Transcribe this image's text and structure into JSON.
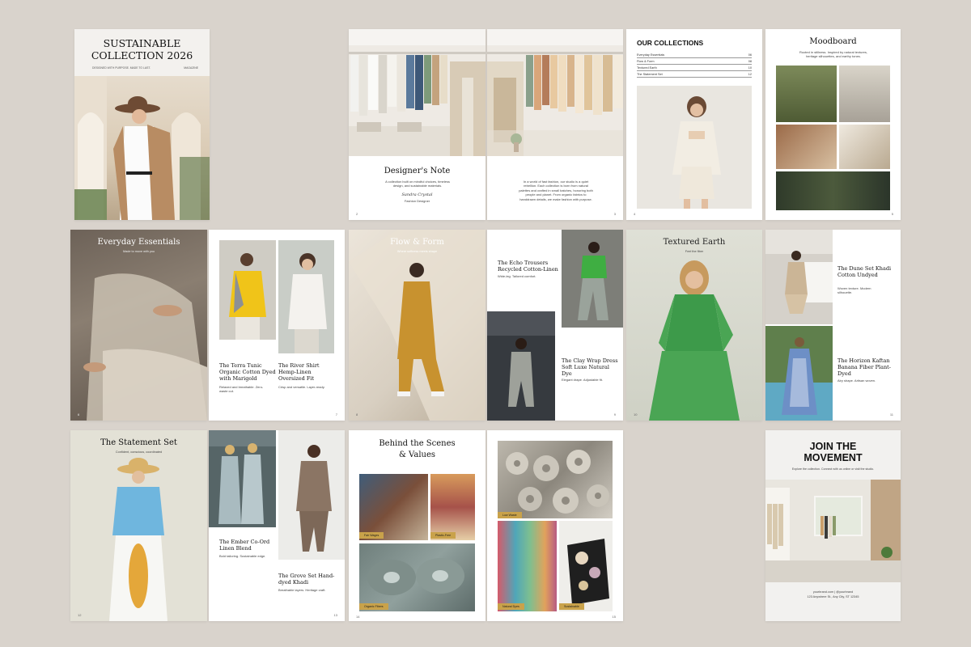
{
  "cover": {
    "title_line1": "SUSTAINABLE",
    "title_line2": "COLLECTION 2026",
    "subtitle": "DESIGNED WITH PURPOSE. MADE TO LAST.",
    "label": "MAGAZINE"
  },
  "designer_note": {
    "title": "Designer's Note",
    "intro": "A collection built on mindful choices, timeless design, and sustainable materials.",
    "signature": "Sandra Crystal",
    "role": "Fashion Designer",
    "body": "In a world of fast fashion, our studio is a quiet rebellion. Each collection is born from natural palettes and crafted in small batches, honoring both people and planet. From organic fabrics to handdrawn details, we make fashion with purpose.",
    "page_left": "2",
    "page_right": "3"
  },
  "collections": {
    "title": "OUR COLLECTIONS",
    "toc": [
      {
        "name": "Everyday Essentials",
        "page": "06"
      },
      {
        "name": "Flow & Form",
        "page": "08"
      },
      {
        "name": "Textured Earth",
        "page": "10"
      },
      {
        "name": "The Statement Set",
        "page": "12"
      }
    ],
    "page": "4"
  },
  "moodboard": {
    "title": "Moodboard",
    "text": "Rooted in stillness. Inspired by natural textures, heritage silhouettes, and earthy tones.",
    "page": "5"
  },
  "everyday": {
    "title": "Everyday Essentials",
    "subtitle": "Made to move with you",
    "page_left": "6",
    "page_right": "7",
    "item1_title": "The Terra Tunic Organic Cotton Dyed with Marigold",
    "item1_desc": "Relaxed and breathable. Zero-waste cut.",
    "item2_title": "The River Shirt Hemp-Linen Oversized Fit",
    "item2_desc": "Crisp and versatile. Layer-ready."
  },
  "flow": {
    "title": "Flow & Form",
    "subtitle": "Where softness meets shape",
    "page_left": "8",
    "page_right": "9",
    "item1_title": "The Echo Trousers Recycled Cotton-Linen",
    "item1_desc": "Wide-leg. Tailored comfort.",
    "item2_title": "The Clay Wrap Dress Soft Luxe Natural Dye",
    "item2_desc": "Elegant drape. Adjustable fit."
  },
  "textured": {
    "title": "Textured Earth",
    "subtitle": "Feel the fiber",
    "page_left": "10",
    "page_right": "11",
    "item1_title": "The Dune Set Khadi Cotton Undyed",
    "item1_desc": "Woven texture. Modern silhouette.",
    "item2_title": "The Horizon Kaftan Banana Fiber Plant-Dyed",
    "item2_desc": "Airy shape. Artisan woven."
  },
  "statement": {
    "title": "The Statement Set",
    "subtitle": "Confident, conscious, coordinated",
    "page_left": "12",
    "page_right": "13",
    "item1_title": "The Ember Co-Ord Linen Blend",
    "item1_desc": "Bold tailoring. Sustainable edge.",
    "item2_title": "The Grove Set Hand-dyed Khadi",
    "item2_desc": "Breathable layers. Heritage craft."
  },
  "behind": {
    "title_line1": "Behind the Scenes",
    "title_line2": "& Values",
    "page_left": "14",
    "page_right": "15",
    "tags": [
      "Fair Wages",
      "Plastic-Free",
      "Organic Fibers",
      "Low Waste",
      "Natural Dyes",
      "Sustainable"
    ]
  },
  "join": {
    "title_line1": "JOIN THE",
    "title_line2": "MOVEMENT",
    "text": "Explore the collection. Connect with us online or visit the studio.",
    "contact1": "yourbrand.com | @yourbrand",
    "contact2": "123 Anywhere St., Any City, ST 12345"
  },
  "colors": {
    "background": "#d9d3cc",
    "accent_tag": "#c9a24a"
  }
}
